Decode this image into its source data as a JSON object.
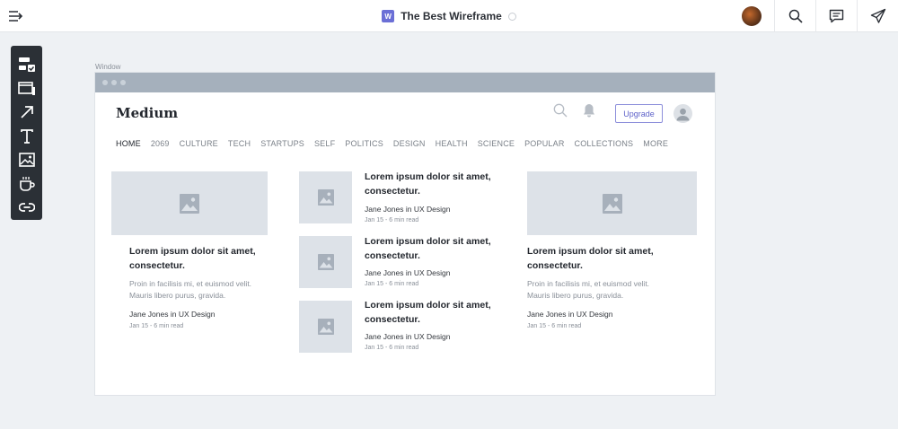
{
  "document": {
    "badge": "W",
    "title": "The Best Wireframe"
  },
  "window_label": "Window",
  "site": {
    "logo": "Medium",
    "upgrade_label": "Upgrade",
    "nav": [
      "HOME",
      "2069",
      "CULTURE",
      "TECH",
      "STARTUPS",
      "SELF",
      "POLITICS",
      "DESIGN",
      "HEALTH",
      "SCIENCE",
      "POPULAR",
      "COLLECTIONS",
      "MORE"
    ]
  },
  "featured": [
    {
      "title": "Lorem ipsum dolor sit amet, consectetur.",
      "excerpt": "Proin in facilisis mi, et euismod velit. Mauris libero purus, gravida.",
      "author": "Jane Jones in UX Design",
      "meta": "Jan 15  -  6 min read"
    },
    {
      "title": "Lorem ipsum dolor sit amet, consectetur.",
      "excerpt": "Proin in facilisis mi, et euismod velit. Mauris libero purus, gravida.",
      "author": "Jane Jones in UX Design",
      "meta": "Jan 15  -  6 min read"
    }
  ],
  "list": [
    {
      "title": "Lorem ipsum dolor sit amet, consectetur.",
      "author": "Jane Jones in UX Design",
      "meta": "Jan 15  -  6 min read"
    },
    {
      "title": "Lorem ipsum dolor sit amet, consectetur.",
      "author": "Jane Jones in UX Design",
      "meta": "Jan 15  -  6 min read"
    },
    {
      "title": "Lorem ipsum dolor sit amet, consectetur.",
      "author": "Jane Jones in UX Design",
      "meta": "Jan 15  -  6 min read"
    }
  ],
  "icons": {
    "topbar": [
      "menu-collapse-icon",
      "search-icon",
      "comment-icon",
      "send-icon"
    ],
    "toolbar": [
      "components-icon",
      "window-icon",
      "arrow-icon",
      "text-icon",
      "image-icon",
      "coffee-icon",
      "link-icon"
    ],
    "placeholder": "image-placeholder-icon"
  },
  "colors": {
    "accent": "#6b6fd6",
    "toolbar_bg": "#2b3036",
    "placeholder_bg": "#dde2e8",
    "window_bar": "#a5b0bc"
  }
}
